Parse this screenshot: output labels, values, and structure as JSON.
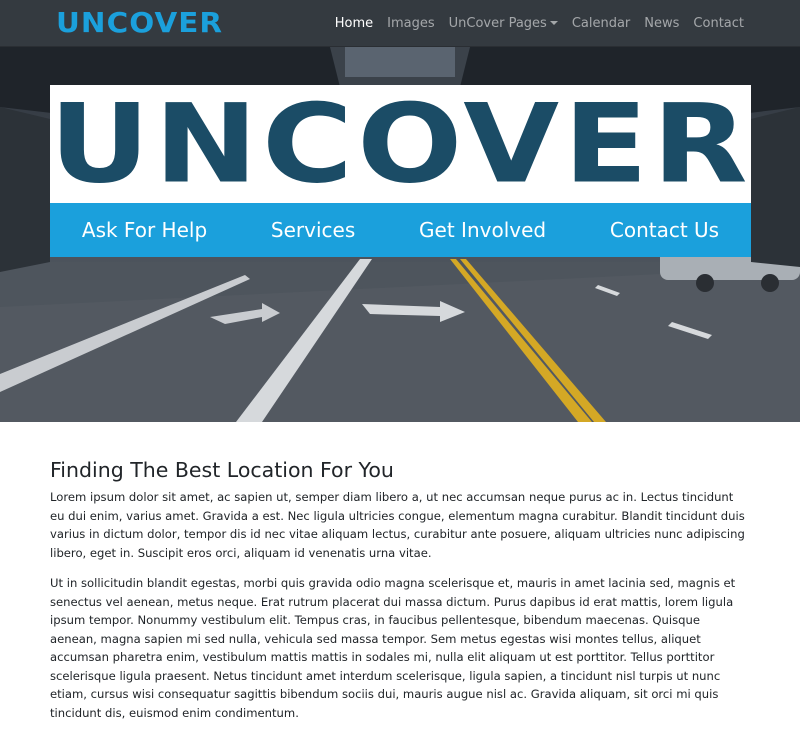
{
  "navbar": {
    "brand": "UNCOVER",
    "items": [
      {
        "label": "Home",
        "active": true
      },
      {
        "label": "Images",
        "active": false
      },
      {
        "label": "UnCover Pages",
        "active": false,
        "dropdown": true
      },
      {
        "label": "Calendar",
        "active": false
      },
      {
        "label": "News",
        "active": false
      },
      {
        "label": "Contact",
        "active": false
      }
    ]
  },
  "hero": {
    "logo_text": "UNCOVER",
    "menu": [
      "Ask For Help",
      "Services",
      "Get Involved",
      "Contact Us"
    ]
  },
  "main": {
    "heading": "Finding The Best Location For You",
    "paragraphs": [
      "Lorem ipsum dolor sit amet, ac sapien ut, semper diam libero a, ut nec accumsan neque purus ac in. Lectus tincidunt eu dui enim, varius amet. Gravida a est. Nec ligula ultricies congue, elementum magna curabitur. Blandit tincidunt duis varius in dictum dolor, tempor dis id nec vitae aliquam lectus, curabitur ante posuere, aliquam ultricies nunc adipiscing libero, eget in. Suscipit eros orci, aliquam id venenatis urna vitae.",
      "Ut in sollicitudin blandit egestas, morbi quis gravida odio magna scelerisque et, mauris in amet lacinia sed, magnis et senectus vel aenean, metus neque. Erat rutrum placerat dui massa dictum. Purus dapibus id erat mattis, lorem ligula ipsum tempor. Nonummy vestibulum elit. Tempus cras, in faucibus pellentesque, bibendum maecenas. Quisque aenean, magna sapien mi sed nulla, vehicula sed massa tempor. Sem metus egestas wisi montes tellus, aliquet accumsan pharetra enim, vestibulum mattis mattis in sodales mi, nulla elit aliquam ut est porttitor. Tellus porttitor scelerisque ligula praesent. Netus tincidunt amet interdum scelerisque, ligula sapien, a tincidunt nisl turpis ut nunc etiam, cursus wisi consequatur sagittis bibendum sociis dui, mauris augue nisl ac. Gravida aliquam, sit orci mi quis tincidunt dis, euismod enim condimentum."
    ]
  },
  "colors": {
    "navbar_bg": "#343a40",
    "brand": "#1ba0dc",
    "logo_text": "#1b4c66",
    "menu_bar": "#1ba0dc"
  }
}
